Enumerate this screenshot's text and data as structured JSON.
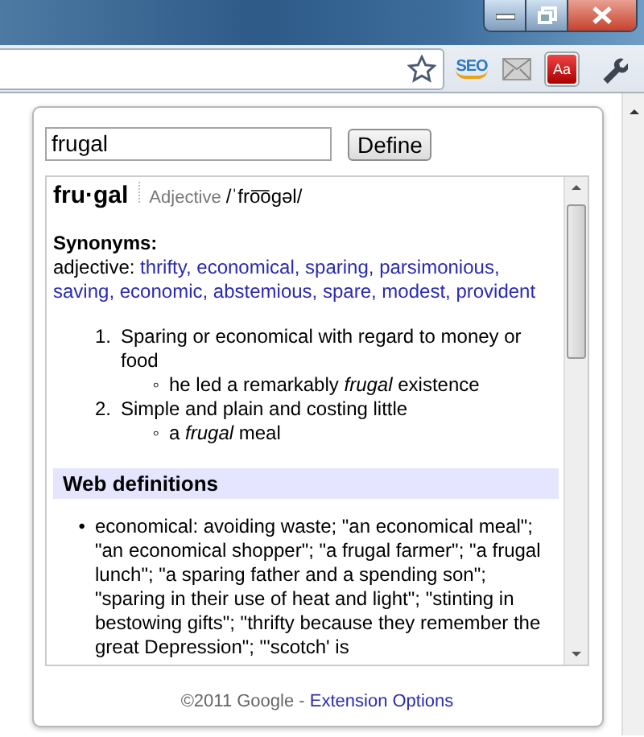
{
  "toolbar": {
    "extensions": [
      {
        "kind": "seo",
        "label": "SEO",
        "selected": false
      },
      {
        "kind": "mail",
        "selected": false
      },
      {
        "kind": "dictionary",
        "label": "Aa",
        "selected": true
      }
    ]
  },
  "popup": {
    "search": {
      "value": "frugal"
    },
    "define_button": "Define",
    "entry": {
      "word": "fru·gal",
      "part_of_speech": "Adjective",
      "pronunciation": "/ˈfro͞ogəl/",
      "synonyms_heading": "Synonyms:",
      "synonyms_prefix": "adjective:",
      "synonyms": [
        "thrifty,",
        "economical,",
        "sparing,",
        "parsimonious,",
        "saving,",
        "economic,",
        "abstemious,",
        "spare,",
        "modest,",
        "provident"
      ],
      "senses": [
        {
          "number": "1.",
          "definition": "Sparing or economical with regard to money or food",
          "examples": [
            {
              "bullet": "◦",
              "text": "he led a remarkably *frugal* existence"
            }
          ]
        },
        {
          "number": "2.",
          "definition": "Simple and plain and costing little",
          "examples": [
            {
              "bullet": "◦",
              "text": "a *frugal* meal"
            }
          ]
        }
      ],
      "web_heading": "Web definitions",
      "web_definitions": [
        {
          "bullet": "•",
          "text": "economical: avoiding waste; \"an economical meal\"; \"an economical shopper\"; \"a frugal farmer\"; \"a frugal lunch\"; \"a sparing father and a spending son\"; \"sparing in their use of heat and light\"; \"stinting in bestowing gifts\"; \"thrifty because they remember the great Depression\"; \"'scotch' is"
        }
      ]
    },
    "footer": {
      "copyright": "©2011 Google -",
      "link": "Extension Options"
    }
  }
}
